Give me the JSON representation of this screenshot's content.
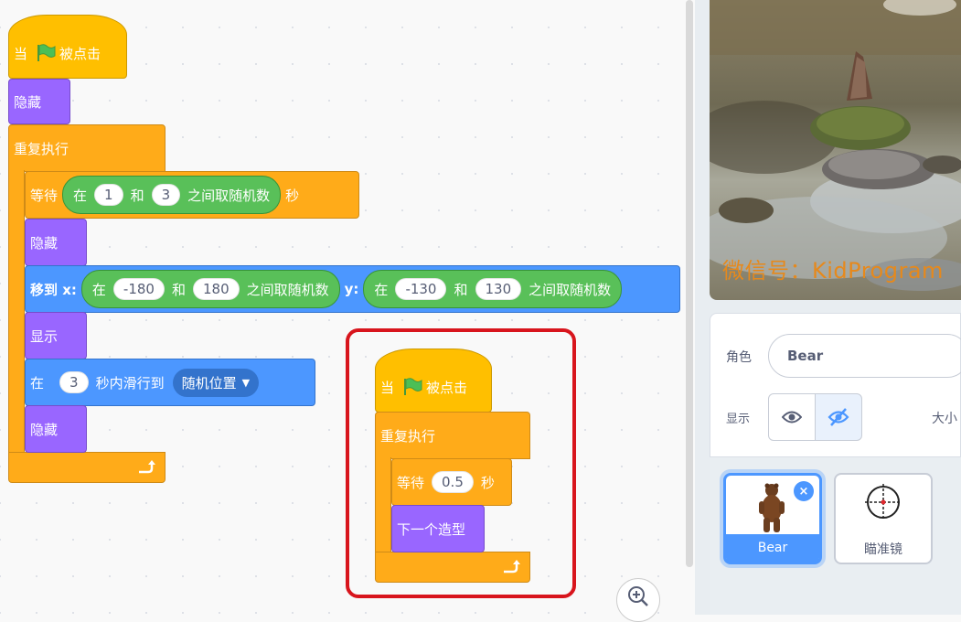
{
  "script1": {
    "hat_when": "当",
    "hat_clicked": "被点击",
    "hide1": "隐藏",
    "forever": "重复执行",
    "wait": {
      "label": "等待",
      "op_in": "在",
      "a": "1",
      "and": "和",
      "b": "3",
      "op_rand": "之间取随机数",
      "unit": "秒"
    },
    "hide2": "隐藏",
    "goto": {
      "label": "移到 x:",
      "op_in": "在",
      "x1": "-180",
      "and": "和",
      "x2": "180",
      "op_rand": "之间取随机数",
      "ylabel": "y:",
      "op_in_y": "在",
      "y1": "-130",
      "and_y": "和",
      "y2": "130",
      "op_rand_y": "之间取随机数"
    },
    "show": "显示",
    "glide": {
      "in": "在",
      "secs": "3",
      "label": "秒内滑行到",
      "target": "随机位置"
    },
    "hide3": "隐藏"
  },
  "script2": {
    "hat_when": "当",
    "hat_clicked": "被点击",
    "forever": "重复执行",
    "wait_label": "等待",
    "wait_value": "0.5",
    "wait_unit": "秒",
    "next_costume": "下一个造型"
  },
  "stage": {
    "watermark": "微信号：KidProgram"
  },
  "sprite_info": {
    "sprite_label": "角色",
    "sprite_name": "Bear",
    "show_label": "显示",
    "size_label": "大小"
  },
  "sprites": [
    {
      "name": "Bear",
      "selected": true
    },
    {
      "name": "瞄准镜",
      "selected": false
    }
  ],
  "colors": {
    "events": "#ffbf00",
    "control": "#ffab19",
    "looks": "#9966ff",
    "motion": "#4c97ff",
    "operators": "#59c059",
    "highlight": "#d8151d"
  }
}
